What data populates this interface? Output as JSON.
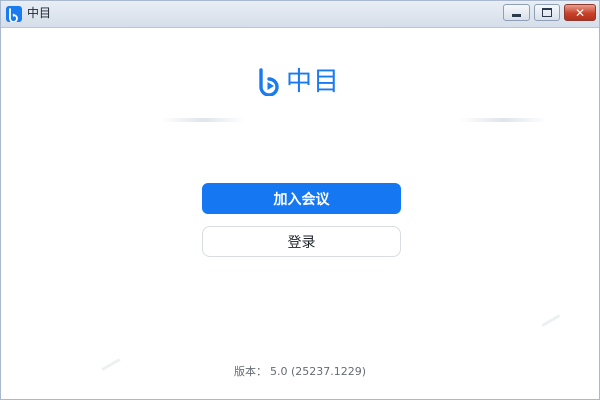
{
  "window": {
    "title": "中目",
    "close_glyph": "✕"
  },
  "logo": {
    "text": "中目",
    "brand_color": "#1a7bf0"
  },
  "actions": {
    "join_label": "加入会议",
    "login_label": "登录",
    "primary_color": "#1677f2"
  },
  "footer": {
    "version_label": "版本：",
    "version_value": "5.0 (25237.1229)"
  },
  "icons": {
    "app": "app-logo-icon",
    "minimize": "minimize-icon",
    "maximize": "maximize-icon",
    "close": "close-icon"
  }
}
